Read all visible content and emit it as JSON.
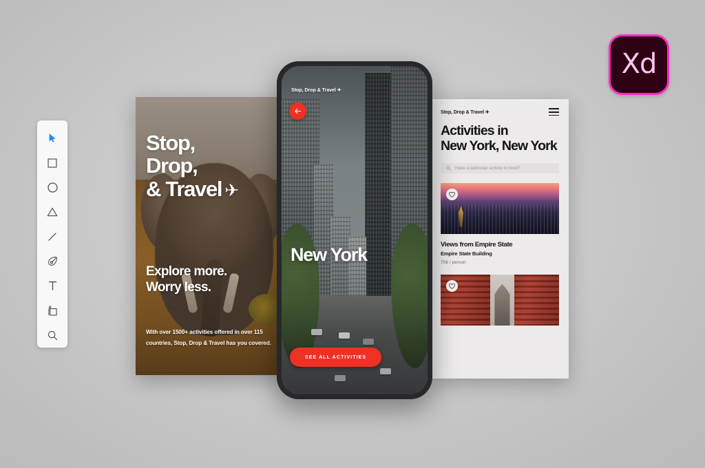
{
  "app": {
    "badge_label": "Xd",
    "badge_name": "adobe-xd",
    "badge_bg": "#2e0014",
    "badge_border": "#ff2bc2",
    "badge_text_color": "#ffc7ef"
  },
  "canvas": {
    "background": "#c9c9c9",
    "accent": "#ef3124"
  },
  "toolbar": {
    "tools": [
      {
        "name": "select-tool",
        "icon": "cursor-arrow-icon",
        "active": true
      },
      {
        "name": "rectangle-tool",
        "icon": "rectangle-icon",
        "active": false
      },
      {
        "name": "ellipse-tool",
        "icon": "ellipse-icon",
        "active": false
      },
      {
        "name": "polygon-tool",
        "icon": "triangle-icon",
        "active": false
      },
      {
        "name": "line-tool",
        "icon": "line-icon",
        "active": false
      },
      {
        "name": "pen-tool",
        "icon": "pen-icon",
        "active": false
      },
      {
        "name": "text-tool",
        "icon": "text-t-icon",
        "active": false
      },
      {
        "name": "artboard-tool",
        "icon": "artboard-icon",
        "active": false
      },
      {
        "name": "zoom-tool",
        "icon": "magnifier-icon",
        "active": false
      }
    ]
  },
  "poster": {
    "headline_line1": "Stop,",
    "headline_line2": "Drop,",
    "headline_line3": "& Travel",
    "headline_plane": "✈",
    "subhead_line1": "Explore more.",
    "subhead_line2": "Worry less.",
    "body_line1": "With over 1500+ activities offered in over 115",
    "body_line2": "countries, Stop, Drop & Travel has you covered."
  },
  "phone": {
    "brand": "Stop, Drop & Travel ✈",
    "back_icon": "arrow-left-icon",
    "city_title": "New York",
    "cta_label": "SEE ALL ACTIVITIES"
  },
  "web": {
    "brand": "Stop, Drop & Travel ✈",
    "menu_icon": "hamburger-menu-icon",
    "title_line1": "Activities in",
    "title_line2": "New York, New York",
    "search": {
      "icon": "search-icon",
      "placeholder": "Have a particular activity in mind?",
      "value": ""
    },
    "cards": [
      {
        "title": "Views from Empire State",
        "subtitle": "Empire State Building",
        "price": "70€ / person",
        "favorite_icon": "heart-icon",
        "image": "empire-state-skyline-sunset"
      },
      {
        "title": "",
        "subtitle": "",
        "price": "",
        "favorite_icon": "heart-icon",
        "image": "manhattan-bridge-dumbo"
      }
    ]
  }
}
